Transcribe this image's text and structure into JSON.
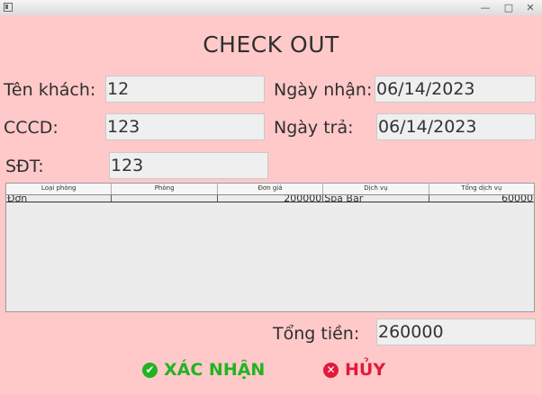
{
  "window": {
    "min_glyph": "—",
    "max_glyph": "□",
    "close_glyph": "✕"
  },
  "title": "CHECK OUT",
  "form": {
    "ten_khach": {
      "label": "Tên khách:",
      "value": "12"
    },
    "cccd": {
      "label": "CCCD:",
      "value": "123"
    },
    "sdt": {
      "label": "SĐT:",
      "value": "123"
    },
    "ngay_nhan": {
      "label": "Ngày nhận:",
      "value": "06/14/2023"
    },
    "ngay_tra": {
      "label": "Ngày trả:",
      "value": "06/14/2023"
    }
  },
  "table": {
    "columns": [
      "Loại phòng",
      "Phòng",
      "Đơn giá",
      "Dịch vụ",
      "Tổng dịch vụ"
    ],
    "rows": [
      [
        "Đơn",
        "",
        "200000",
        "Spa Bar",
        "60000"
      ]
    ]
  },
  "total": {
    "label": "Tổng tiền:",
    "value": "260000"
  },
  "buttons": {
    "confirm": {
      "label": "XÁC NHẬN",
      "icon": "check-circle-icon",
      "color": "#22b322",
      "glyph": "✔"
    },
    "cancel": {
      "label": "HỦY",
      "icon": "x-circle-icon",
      "color": "#e21a3a",
      "glyph": "✕"
    }
  }
}
